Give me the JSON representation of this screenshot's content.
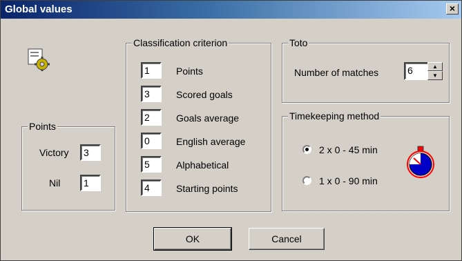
{
  "window": {
    "title": "Global values",
    "close_glyph": "×"
  },
  "points": {
    "legend": "Points",
    "victory_label": "Victory",
    "victory_value": "3",
    "nil_label": "Nil",
    "nil_value": "1"
  },
  "classification": {
    "legend": "Classification criterion",
    "rows": [
      {
        "value": "1",
        "label": "Points"
      },
      {
        "value": "3",
        "label": "Scored goals"
      },
      {
        "value": "2",
        "label": "Goals average"
      },
      {
        "value": "0",
        "label": "English average"
      },
      {
        "value": "5",
        "label": "Alphabetical"
      },
      {
        "value": "4",
        "label": "Starting points"
      }
    ]
  },
  "toto": {
    "legend": "Toto",
    "matches_label": "Number of matches",
    "matches_value": "6"
  },
  "timekeeping": {
    "legend": "Timekeeping method",
    "options": [
      {
        "label": "2 x 0 - 45 min",
        "selected": true
      },
      {
        "label": "1 x 0 - 90 min",
        "selected": false
      }
    ]
  },
  "buttons": {
    "ok": "OK",
    "cancel": "Cancel"
  },
  "icons": {
    "app": "settings-gear-icon",
    "stopwatch": "stopwatch-icon"
  },
  "colors": {
    "title_start": "#0a246a",
    "title_end": "#a6caf0",
    "face": "#d4d0c8"
  }
}
